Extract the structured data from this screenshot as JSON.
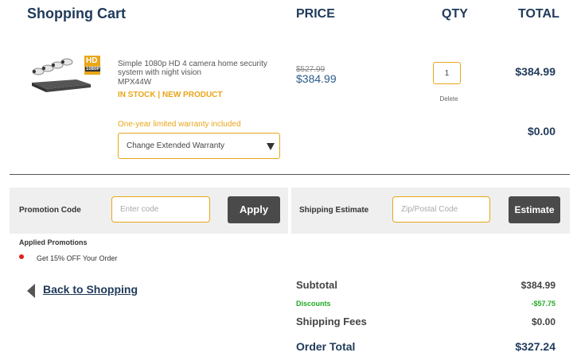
{
  "header": {
    "title": "Shopping Cart",
    "price": "PRICE",
    "qty": "QTY",
    "total": "TOTAL"
  },
  "item": {
    "hd_badge": "HD",
    "hd_sub": "1080P",
    "description": "Simple 1080p HD 4 camera home security system with night vision",
    "sku": "MPX44W",
    "status": "IN STOCK | NEW PRODUCT",
    "was_price": "$527.99",
    "price": "$384.99",
    "qty": "1",
    "delete_label": "Delete",
    "line_total": "$384.99",
    "warranty_label": "One-year limited warranty included",
    "warranty_select": "Change Extended Warranty",
    "warranty_total": "$0.00"
  },
  "promotion": {
    "label": "Promotion Code",
    "placeholder": "Enter code",
    "button": "Apply",
    "applied_label": "Applied Promotions",
    "applied_item": "Get 15% OFF Your Order"
  },
  "shipping": {
    "label": "Shipping Estimate",
    "placeholder": "Zip/Postal Code",
    "button": "Estimate"
  },
  "nav": {
    "back": "Back to Shopping"
  },
  "summary": {
    "subtotal_label": "Subtotal",
    "subtotal": "$384.99",
    "discounts_label": "Discounts",
    "discounts": "-$57.75",
    "shipping_label": "Shipping Fees",
    "shipping": "$0.00",
    "total_label": "Order Total",
    "total": "$327.24"
  }
}
